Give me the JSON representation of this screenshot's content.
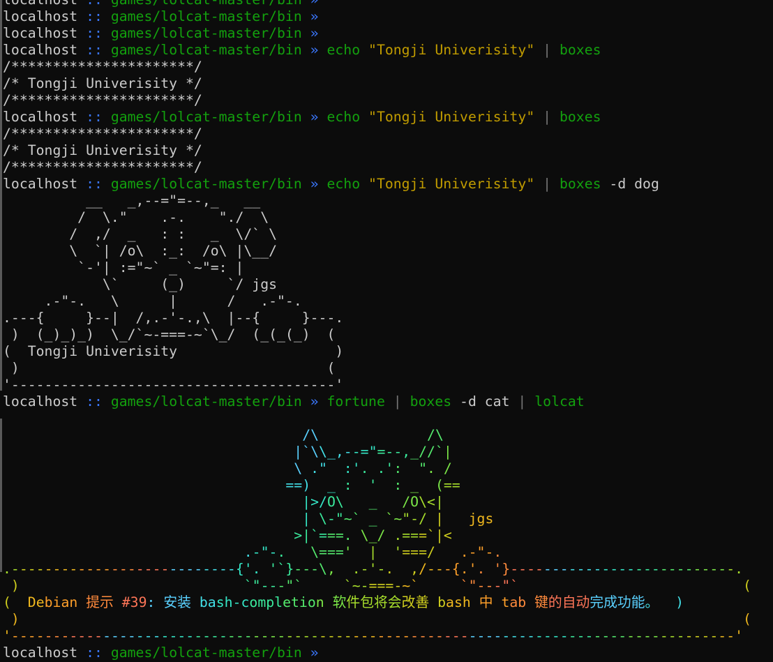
{
  "prompt": {
    "host": "localhost",
    "sep": " :: ",
    "path": "games/lolcat-master/bin",
    "arrow": " » "
  },
  "colors": {
    "background": "#0c0c0c",
    "foreground": "#cccccc",
    "host": "#cccccc",
    "separator": "#3b78ff",
    "path": "#13a10e",
    "arrow": "#3b78ff",
    "command": "#13a10e",
    "string": "#c19c00",
    "pipe": "#767676",
    "rainbow": [
      "#5ad1ff",
      "#43e0e8",
      "#35e8c8",
      "#3bec9e",
      "#55ec6e",
      "#7ce848",
      "#a7de2c",
      "#d0cf1e",
      "#f0b81e",
      "#ffa02a",
      "#ff8a3c",
      "#ff7658"
    ]
  },
  "lines": [
    {
      "type": "prompt",
      "tokens": []
    },
    {
      "type": "prompt",
      "tokens": []
    },
    {
      "type": "prompt",
      "tokens": []
    },
    {
      "type": "prompt",
      "tokens": [
        {
          "t": "echo",
          "c": "cmd"
        },
        {
          "t": " ",
          "c": "opt"
        },
        {
          "t": "\"Tongji Univerisity\"",
          "c": "str"
        },
        {
          "t": " | ",
          "c": "pipe"
        },
        {
          "t": "boxes",
          "c": "cmd"
        }
      ]
    },
    {
      "type": "out",
      "text": "/**********************/"
    },
    {
      "type": "out",
      "text": "/* Tongji Univerisity */"
    },
    {
      "type": "out",
      "text": "/**********************/"
    },
    {
      "type": "prompt",
      "tokens": [
        {
          "t": "echo",
          "c": "cmd"
        },
        {
          "t": " ",
          "c": "opt"
        },
        {
          "t": "\"Tongji Univerisity\"",
          "c": "str"
        },
        {
          "t": " | ",
          "c": "pipe"
        },
        {
          "t": "boxes",
          "c": "cmd"
        }
      ]
    },
    {
      "type": "out",
      "text": "/**********************/"
    },
    {
      "type": "out",
      "text": "/* Tongji Univerisity */"
    },
    {
      "type": "out",
      "text": "/**********************/"
    },
    {
      "type": "prompt",
      "tokens": [
        {
          "t": "echo",
          "c": "cmd"
        },
        {
          "t": " ",
          "c": "opt"
        },
        {
          "t": "\"Tongji Univerisity\"",
          "c": "str"
        },
        {
          "t": " | ",
          "c": "pipe"
        },
        {
          "t": "boxes",
          "c": "cmd"
        },
        {
          "t": " -d dog",
          "c": "opt"
        }
      ]
    },
    {
      "type": "out",
      "text": "          __   _,--=\"=--,_   __"
    },
    {
      "type": "out",
      "text": "         /  \\.\"    .-.    \"./  \\"
    },
    {
      "type": "out",
      "text": "        /  ,/  _   : :   _  \\/` \\"
    },
    {
      "type": "out",
      "text": "        \\  `| /o\\  :_:  /o\\ |\\__/"
    },
    {
      "type": "out",
      "text": "         `-'| :=\"~` _ `~\"=: |"
    },
    {
      "type": "out",
      "text": "            \\`     (_)     `/ jgs"
    },
    {
      "type": "out",
      "text": "     .-\"-.   \\      |      /   .-\"-."
    },
    {
      "type": "out",
      "text": ".---{     }--|  /,.-'-.,\\  |--{     }---."
    },
    {
      "type": "out",
      "text": " )  (_)_)_)  \\_/`~-===-~`\\_/  (_(_(_)  ("
    },
    {
      "type": "out",
      "text": "(  Tongji Univerisity                   )"
    },
    {
      "type": "out",
      "text": " )                                     ("
    },
    {
      "type": "out",
      "text": "'---------------------------------------'"
    },
    {
      "type": "prompt",
      "tokens": [
        {
          "t": "fortune",
          "c": "cmd"
        },
        {
          "t": " | ",
          "c": "pipe"
        },
        {
          "t": "boxes",
          "c": "cmd"
        },
        {
          "t": " -d cat ",
          "c": "opt"
        },
        {
          "t": "|",
          "c": "pipe"
        },
        {
          "t": " lolcat",
          "c": "cmd"
        }
      ]
    },
    {
      "type": "rainbow",
      "text": ""
    },
    {
      "type": "rainbow",
      "text": "                                    /\\             /\\"
    },
    {
      "type": "rainbow",
      "text": "                                   |`\\\\_,--=\"=--,_//`|"
    },
    {
      "type": "rainbow",
      "text": "                                   \\ .\"  :'. .':  \". /"
    },
    {
      "type": "rainbow",
      "text": "                                  ==)  _ :  '  : _  (=="
    },
    {
      "type": "rainbow",
      "text": "                                    |>/O\\   _   /O\\<|"
    },
    {
      "type": "rainbow",
      "text": "                                    | \\-\"~` _ `~\"-/ |   jgs"
    },
    {
      "type": "rainbow",
      "text": "                                   >|`===. \\_/ .===`|<"
    },
    {
      "type": "rainbow",
      "text": "                             .-\"-.   \\==='  |  '===/   .-\"-."
    },
    {
      "type": "rainbow",
      "text": ".---------------------------{'. '`}---\\,  .-'-.  ,/---{.'. '}---------------------------."
    },
    {
      "type": "rainbow",
      "text": " )                           `\"---\"`     `~-===-~`     `\"---\"`                           ("
    },
    {
      "type": "rainbow",
      "text": "(  Debian 提示 #39: 安装 bash-completion 软件包将会改善 bash 中 tab 键的自动完成功能。  )"
    },
    {
      "type": "rainbow",
      "text": " )                                                                                       ("
    },
    {
      "type": "rainbow",
      "text": "'---------------------------------------------------------------------------------------'"
    },
    {
      "type": "prompt",
      "tokens": []
    }
  ]
}
